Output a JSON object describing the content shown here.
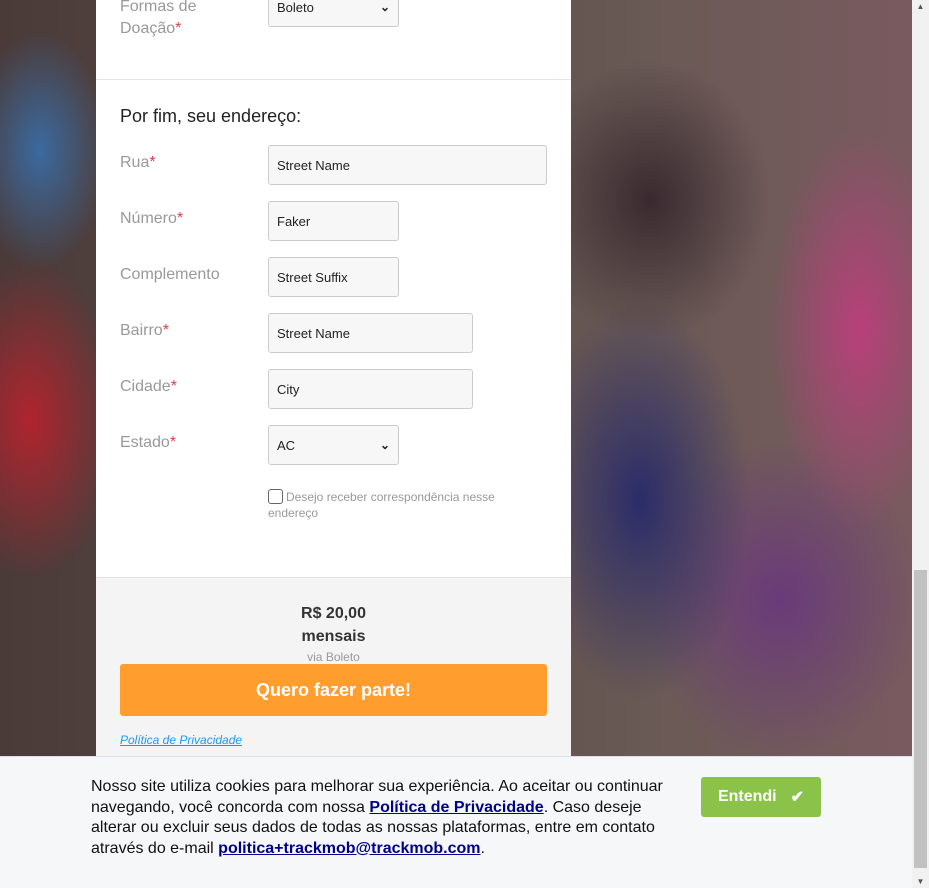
{
  "donation": {
    "label": "Formas de Doação",
    "required": "*",
    "value": "Boleto"
  },
  "address": {
    "heading": "Por fim, seu endereço:",
    "fields": [
      {
        "label": "Rua",
        "required": "*",
        "value": "Street Name"
      },
      {
        "label": "Número",
        "required": "*",
        "value": "Faker"
      },
      {
        "label": "Complemento",
        "required": "",
        "value": "Street Suffix"
      },
      {
        "label": "Bairro",
        "required": "*",
        "value": "Street Name"
      },
      {
        "label": "Cidade",
        "required": "*",
        "value": "City"
      },
      {
        "label": "Estado",
        "required": "*",
        "value": "AC"
      }
    ],
    "checkbox_label": "Desejo receber correspondência nesse endereço"
  },
  "summary": {
    "amount": "R$ 20,00",
    "period": "mensais",
    "method": "via Boleto",
    "submit": "Quero fazer parte!",
    "privacy": "Política de Privacidade"
  },
  "cookie": {
    "text1": "Nosso site utiliza cookies para melhorar sua experiência. Ao aceitar ou continuar navegando, você concorda com nossa ",
    "link": "Política de Privacidade",
    "text2": ". Caso deseje alterar ou excluir seus dados de todas as nossas plataformas, entre em contato através do e-mail ",
    "email": "politica+trackmob@trackmob.com",
    "text3": ".",
    "button": "Entendi"
  },
  "colors": {
    "accent": "#ff9d2e",
    "green": "#8bc34a",
    "required": "#e04050"
  }
}
